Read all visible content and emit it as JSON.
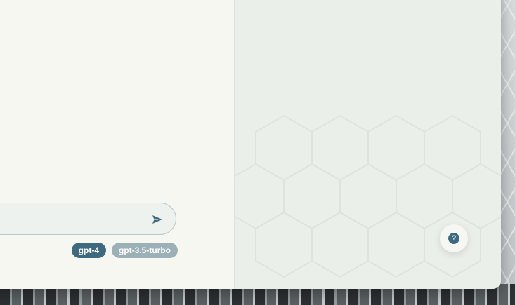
{
  "composer": {
    "send_icon": "send-icon",
    "placeholder": ""
  },
  "models": [
    {
      "label": "gpt-4",
      "selected": true
    },
    {
      "label": "gpt-3.5-turbo",
      "selected": false
    }
  ],
  "help": {
    "glyph": "?",
    "icon": "help-icon"
  },
  "colors": {
    "accent": "#3e6a80",
    "inactive_chip": "#9cb0b8",
    "panel": "#f6f7f1",
    "side_panel": "#ebefea"
  }
}
